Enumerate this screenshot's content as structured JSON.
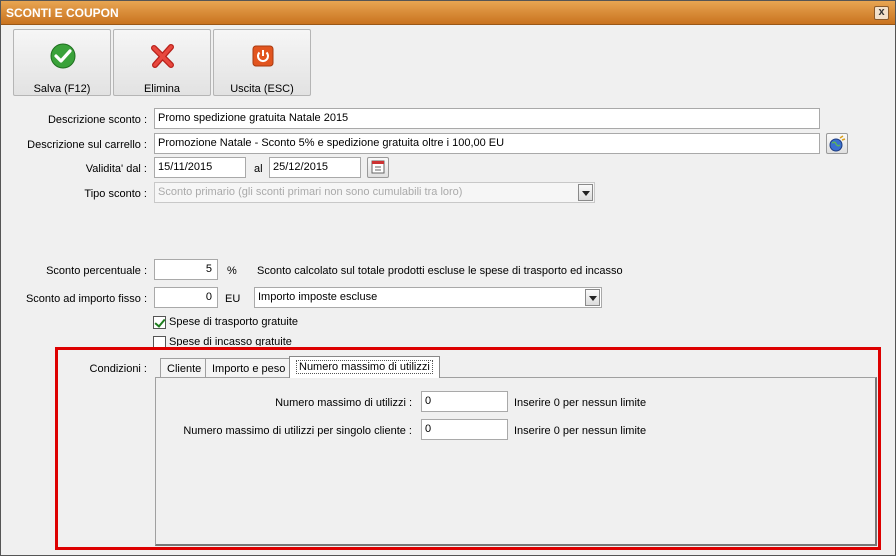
{
  "window": {
    "title": "SCONTI E COUPON",
    "close_glyph": "x"
  },
  "toolbar": {
    "save_label": "Salva (F12)",
    "delete_label": "Elimina",
    "exit_label": "Uscita (ESC)",
    "save_icon": "checkmark-circle-icon",
    "delete_icon": "red-x-icon",
    "exit_icon": "power-icon"
  },
  "form": {
    "descrizione_label": "Descrizione sconto :",
    "descrizione_value": "Promo spedizione gratuita Natale 2015",
    "carrello_label": "Descrizione sul carrello :",
    "carrello_value": "Promozione Natale - Sconto 5% e spedizione gratuita oltre i 100,00 EU",
    "validita_label": "Validita' dal :",
    "validita_from": "15/11/2015",
    "validita_al_label": "al",
    "validita_to": "25/12/2015",
    "tipo_label": "Tipo sconto :",
    "tipo_value": "Sconto primario (gli sconti primari non sono cumulabili tra loro)",
    "percentuale_label": "Sconto percentuale :",
    "percentuale_value": "5",
    "percentuale_unit": "%",
    "percentuale_note": "Sconto calcolato sul totale prodotti escluse le spese di trasporto ed incasso",
    "importo_label": "Sconto ad importo fisso :",
    "importo_value": "0",
    "importo_unit": "EU",
    "importo_select": "Importo imposte escluse",
    "trasporto_label": "Spese di trasporto gratuite",
    "trasporto_checked": true,
    "incasso_label": "Spese di incasso gratuite",
    "incasso_checked": false
  },
  "conditions": {
    "label": "Condizioni :",
    "tabs": [
      {
        "label": "Cliente",
        "active": false
      },
      {
        "label": "Importo e peso",
        "active": false
      },
      {
        "label": "Numero massimo di utilizzi",
        "active": true
      }
    ],
    "max_label": "Numero massimo di utilizzi :",
    "max_value": "0",
    "max_hint": "Inserire 0 per nessun limite",
    "max_cliente_label": "Numero massimo di utilizzi per singolo cliente :",
    "max_cliente_value": "0",
    "max_cliente_hint": "Inserire 0 per nessun limite"
  },
  "colors": {
    "titlebar": "#d98a35",
    "highlight": "#dd0000",
    "check": "#1e7d1e"
  }
}
